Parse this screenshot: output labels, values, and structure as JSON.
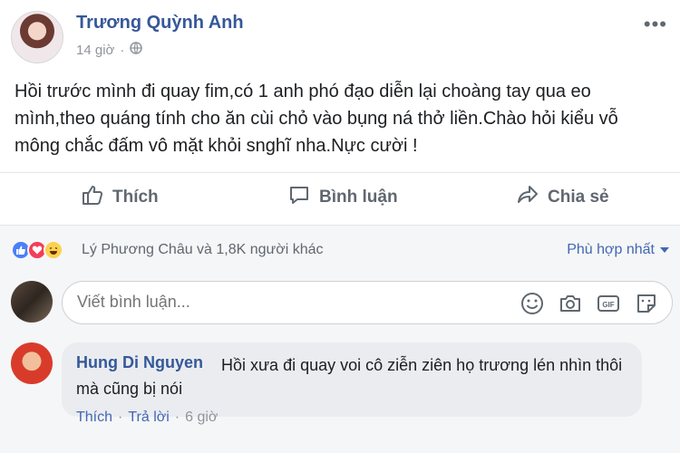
{
  "post": {
    "author": "Trương Quỳnh Anh",
    "time": "14 giờ",
    "separator": "·",
    "text": "Hồi trước mình đi quay fim,có 1 anh phó đạo diễn lại choàng tay qua eo mình,theo quáng tính cho ăn cùi chỏ vào bụng ná thở liền.Chào hỏi kiểu vỗ mông chắc đấm vô mặt khỏi snghĩ nha.Nực cười !"
  },
  "actions": {
    "like": "Thích",
    "comment": "Bình luận",
    "share": "Chia sẻ"
  },
  "reactions": {
    "summary": "Lý Phương Châu và 1,8K người khác",
    "sort": "Phù hợp nhất"
  },
  "composer": {
    "placeholder": "Viết bình luận..."
  },
  "comment": {
    "author": "Hung Di Nguyen",
    "text": "Hồi xưa đi quay voi cô ziễn ziên họ trương lén nhìn thôi mà cũng bị nói",
    "like": "Thích",
    "reply": "Trả lời",
    "time": "6 giờ",
    "separator": "·"
  },
  "colors": {
    "link": "#365899",
    "accent": "#4267b2",
    "muted": "#90949c",
    "like_reaction": "#4a7ffa",
    "love_reaction": "#f33e58",
    "haha_reaction": "#fbd24f"
  }
}
